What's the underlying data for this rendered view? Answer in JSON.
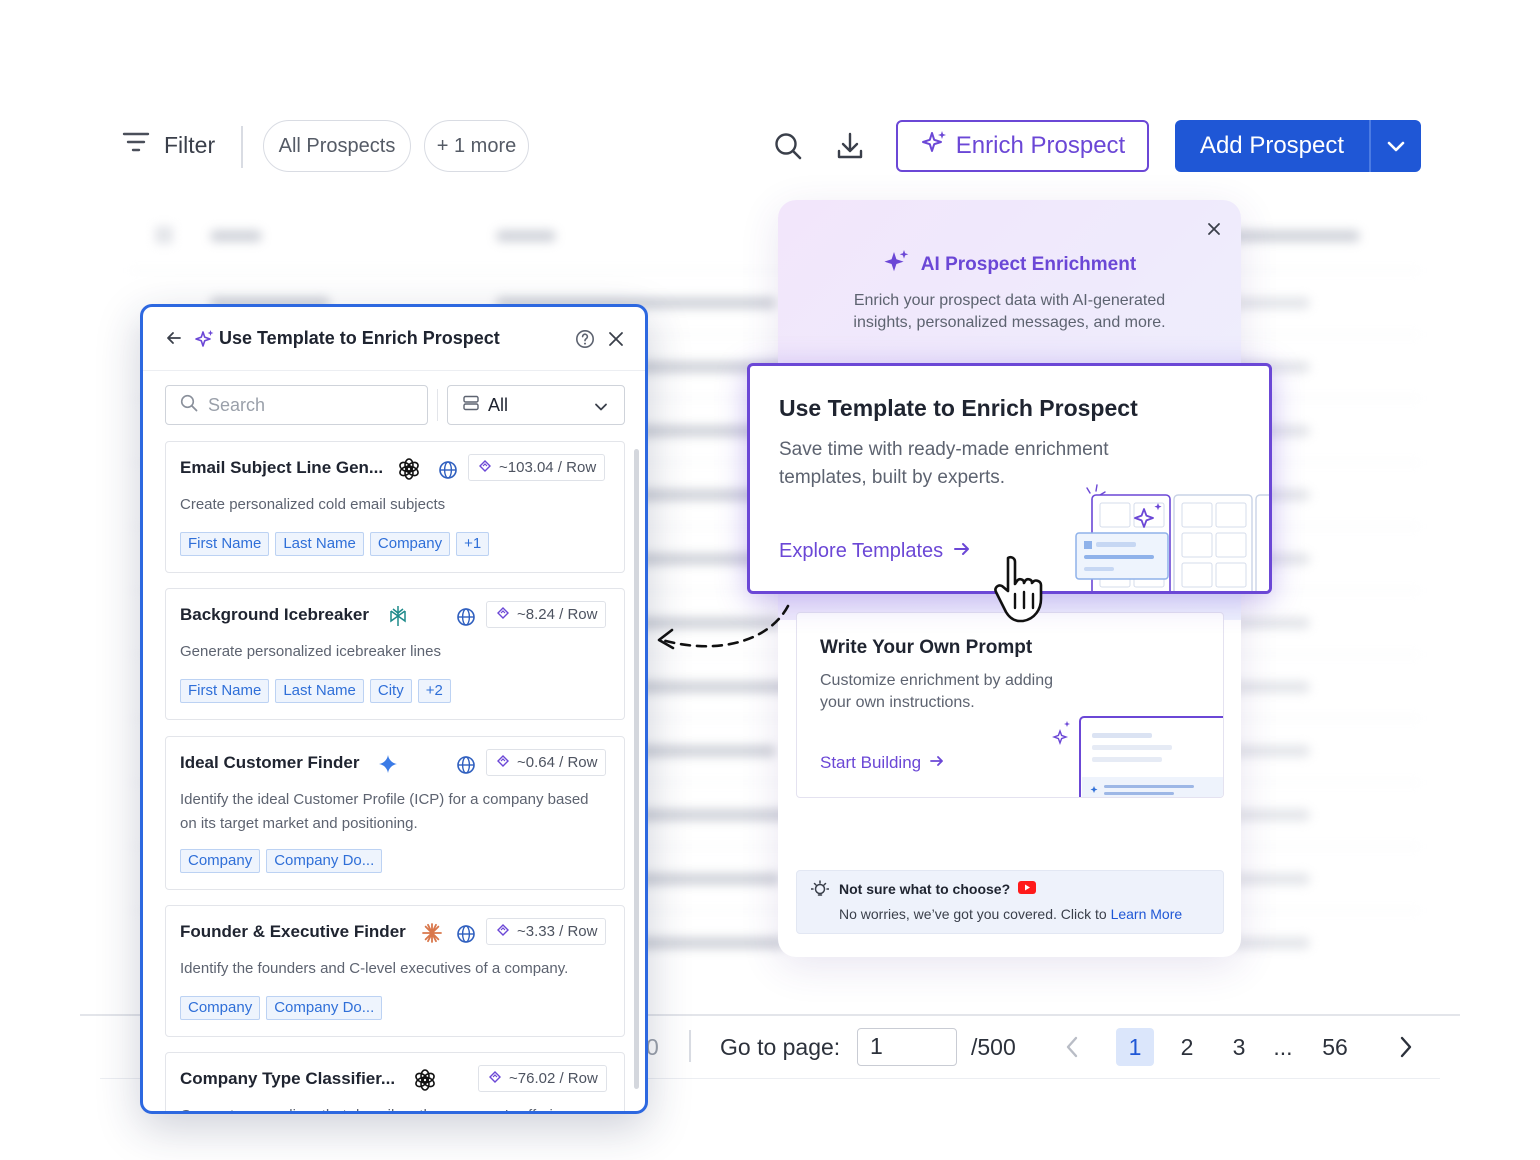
{
  "toolbar": {
    "filter_label": "Filter",
    "chips": [
      "All Prospects",
      "+ 1 more"
    ],
    "enrich_label": "Enrich Prospect",
    "add_label": "Add Prospect"
  },
  "pagination": {
    "partial_text": "0",
    "goto_label": "Go to page:",
    "page_value": "1",
    "total": "/500",
    "pages": [
      "1",
      "2",
      "3",
      "...",
      "56"
    ],
    "active_page": "1"
  },
  "enrich_panel": {
    "title": "AI Prospect Enrichment",
    "subtitle": "Enrich your prospect data with AI-generated insights, personalized messages, and more.",
    "template_card": {
      "title": "Use Template to Enrich Prospect",
      "subtitle": "Save time with ready-made enrichment templates, built by experts.",
      "link": "Explore Templates"
    },
    "own_card": {
      "title": "Write Your Own Prompt",
      "subtitle": "Customize enrichment by adding your own instructions.",
      "link": "Start Building"
    },
    "hint": {
      "title": "Not sure what to choose?",
      "text": "No worries, we’ve got you covered. Click to",
      "link": "Learn More"
    }
  },
  "template_panel": {
    "title": "Use Template to Enrich Prospect",
    "search_placeholder": "Search",
    "filter_value": "All",
    "items": [
      {
        "name": "Email Subject Line Gen...",
        "logo": "openai-icon",
        "price": "~103.04 / Row",
        "description": "Create personalized cold email subjects",
        "tags": [
          "First Name",
          "Last Name",
          "Company",
          "+1"
        ]
      },
      {
        "name": "Background Icebreaker",
        "logo": "perplexity-icon",
        "price": "~8.24 / Row",
        "description": "Generate personalized icebreaker lines",
        "tags": [
          "First Name",
          "Last Name",
          "City",
          "+2"
        ]
      },
      {
        "name": "Ideal Customer Finder",
        "logo": "gemini-icon",
        "price": "~0.64 / Row",
        "description": "Identify the ideal Customer Profile (ICP) for a company based on its target market and positioning.",
        "tags": [
          "Company",
          "Company Do..."
        ]
      },
      {
        "name": "Founder & Executive Finder",
        "logo": "claude-icon",
        "price": "~3.33 / Row",
        "description": "Identify the founders and C-level executives of a company.",
        "tags": [
          "Company",
          "Company Do..."
        ]
      },
      {
        "name": "Company Type Classifier...",
        "logo": "openai-icon",
        "price": "~76.02 / Row",
        "description": "Generate a one-liner that describes the company's offering",
        "tags": []
      }
    ]
  },
  "colors": {
    "accent_purple": "#6b47d6",
    "primary_blue": "#1f57d6",
    "panel_border_blue": "#2d68e0",
    "tag_blue": "#2f6fd8"
  }
}
